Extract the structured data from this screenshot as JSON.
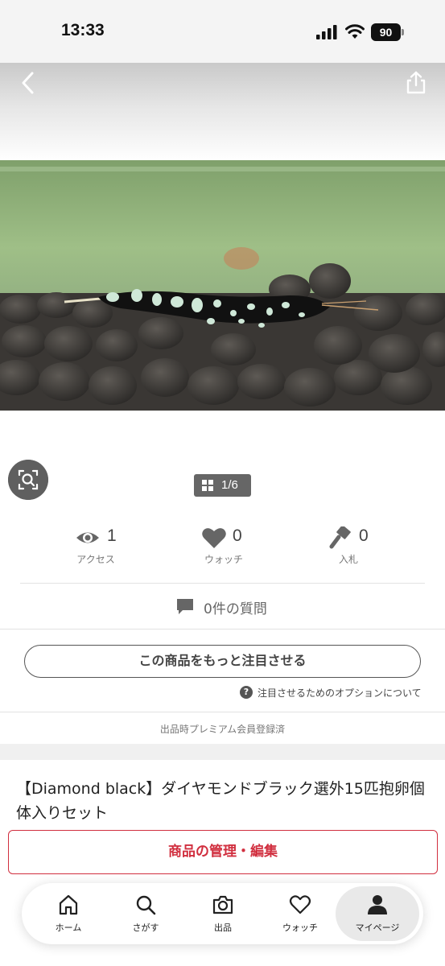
{
  "status": {
    "time": "13:33",
    "battery": "90",
    "icons": [
      "signal-icon",
      "wifi-icon",
      "battery-icon"
    ]
  },
  "header": {
    "back_icon": "chevron-left-icon",
    "share_icon": "share-icon"
  },
  "gallery": {
    "counter": "1/6",
    "lens_icon": "image-search-icon"
  },
  "stats": {
    "access": {
      "value": "1",
      "label": "アクセス",
      "icon": "eye-icon"
    },
    "watch": {
      "value": "0",
      "label": "ウォッチ",
      "icon": "heart-icon"
    },
    "bids": {
      "value": "0",
      "label": "入札",
      "icon": "gavel-icon"
    }
  },
  "qa": {
    "label": "0件の質問",
    "icon": "speech-bubble-icon"
  },
  "promote": {
    "button_label": "この商品をもっと注目させる",
    "help_text": "注目させるためのオプションについて"
  },
  "premium_note": "出品時プレミアム会員登録済",
  "item": {
    "title": "【Diamond black】ダイヤモンドブラック選外15匹抱卵個体入りセット"
  },
  "manage_button": "商品の管理・編集",
  "nav": {
    "items": [
      {
        "label": "ホーム",
        "icon": "home-icon"
      },
      {
        "label": "さがす",
        "icon": "search-icon"
      },
      {
        "label": "出品",
        "icon": "camera-icon"
      },
      {
        "label": "ウォッチ",
        "icon": "heart-icon"
      },
      {
        "label": "マイページ",
        "icon": "person-icon"
      }
    ],
    "active_index": 4
  },
  "colors": {
    "accent": "#d12f3f",
    "badge": "#666666",
    "nav_active": "#e9e9e9"
  }
}
